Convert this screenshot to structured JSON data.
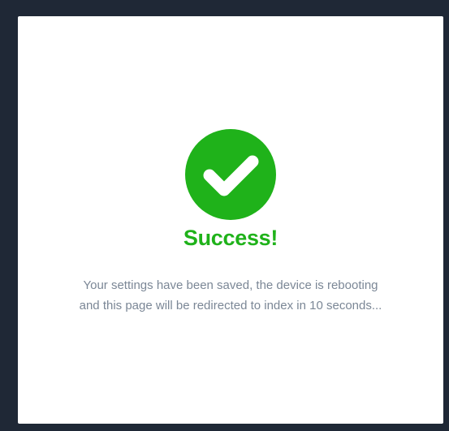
{
  "dialog": {
    "icon": "check-circle-icon",
    "title": "Success!",
    "message": "Your settings have been saved, the device is rebooting and this page will be redirected to index in 10 seconds..."
  },
  "colors": {
    "background": "#1f2836",
    "card": "#ffffff",
    "success": "#1fb21a",
    "message_text": "#7b8796"
  }
}
